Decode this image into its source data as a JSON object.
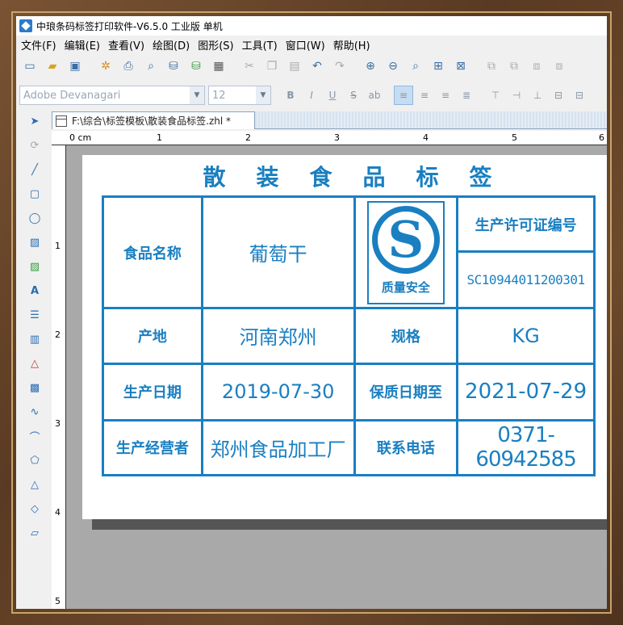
{
  "window": {
    "title": "中琅条码标签打印软件-V6.5.0 工业版 单机"
  },
  "menu": {
    "items": [
      "文件(F)",
      "编辑(E)",
      "查看(V)",
      "绘图(D)",
      "图形(S)",
      "工具(T)",
      "窗口(W)",
      "帮助(H)"
    ]
  },
  "format_toolbar": {
    "font_name": "Adobe Devanagari",
    "font_size": "12"
  },
  "document": {
    "tab_title": "F:\\综合\\标签模板\\散装食品标签.zhl *"
  },
  "ruler": {
    "top_labels": [
      "0 cm",
      "1",
      "2",
      "3",
      "4",
      "5",
      "6"
    ],
    "left_labels": [
      "1",
      "2",
      "3",
      "4",
      "5"
    ]
  },
  "label": {
    "title": "散装食品标签",
    "food_name_label": "食品名称",
    "food_name_value": "葡萄干",
    "qs_text": "质量安全",
    "qs_letter": "S",
    "license_label": "生产许可证编号",
    "license_value": "SC10944011200301",
    "origin_label": "产地",
    "origin_value": "河南郑州",
    "spec_label": "规格",
    "spec_value": "KG",
    "production_date_label": "生产日期",
    "production_date_value": "2019-07-30",
    "shelf_life_label": "保质日期至",
    "shelf_life_value": "2021-07-29",
    "producer_label": "生产经营者",
    "producer_value": "郑州食品加工厂",
    "phone_label": "联系电话",
    "phone_value": "0371-60942585"
  },
  "colors": {
    "accent": "#1a7fc1"
  }
}
